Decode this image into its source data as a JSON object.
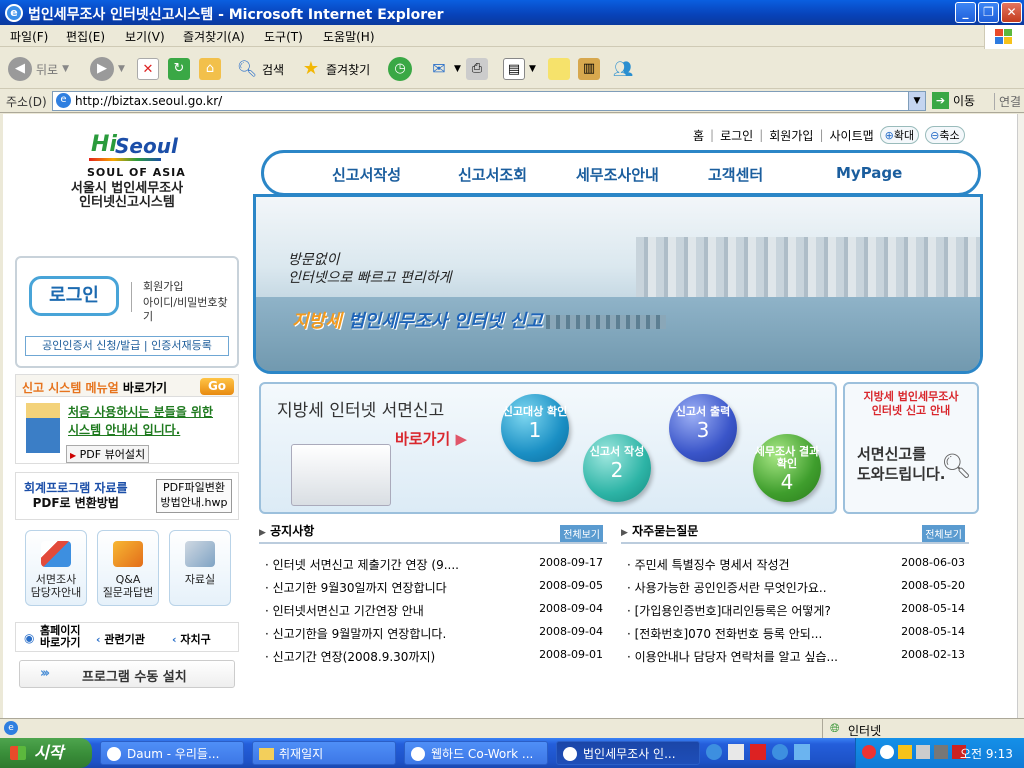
{
  "window": {
    "title": "법인세무조사 인터넷신고시스템 - Microsoft Internet Explorer"
  },
  "menu": [
    "파일(F)",
    "편집(E)",
    "보기(V)",
    "즐겨찾기(A)",
    "도구(T)",
    "도움말(H)"
  ],
  "toolbar": {
    "back": "뒤로",
    "search": "검색",
    "favorites": "즐겨찾기"
  },
  "address": {
    "label": "주소(D)",
    "url": "http://biztax.seoul.go.kr/",
    "go": "이동",
    "links": "연결"
  },
  "site": {
    "logo_hi": "Hi",
    "logo_seoul": "Seoul",
    "logo_sub": "SOUL OF ASIA",
    "title1": "서울시 법인세무조사",
    "title2": "인터넷신고시스템",
    "toplinks": [
      "홈",
      "로그인",
      "회원가입",
      "사이트맵"
    ],
    "zoom_in": "확대",
    "zoom_out": "축소",
    "nav": [
      "신고서작성",
      "신고서조회",
      "세무조사안내",
      "고객센터",
      "MyPage"
    ],
    "banner": {
      "line1": "방문없이",
      "line2": "인터넷으로 빠르고 편리하게",
      "headline_a": "지방세",
      "headline_b": "법인세무조사 인터넷 신고"
    },
    "login": {
      "button": "로그인",
      "join": "회원가입",
      "find": "아이디/비밀번호찾기",
      "cert": "공인인증서 신청/발급",
      "cert_reg": "인증서재등록"
    },
    "manual": {
      "title_a": "신고 시스템 메뉴얼",
      "title_b": "바로가기",
      "go": "Go",
      "line1": "처음 사용하시는 분들을 위한",
      "line2": "시스템 안내서 입니다.",
      "pdf": "PDF 뷰어설치"
    },
    "account": {
      "line1": "회계프로그램 자료를",
      "line2": "PDF로 변환방법",
      "btn1": "PDF파일변환",
      "btn2": "방법안내.hwp"
    },
    "quick": [
      {
        "l1": "서면조사",
        "l2": "담당자안내"
      },
      {
        "l1": "Q&A",
        "l2": "질문과답변"
      },
      {
        "l1": "자료실",
        "l2": ""
      }
    ],
    "homelinks": {
      "home1": "홈페이지",
      "home2": "바로가기",
      "org": "관련기관",
      "gu": "자치구"
    },
    "install": "프로그램 수동 설치",
    "seomyeon": {
      "title": "지방세 인터넷 서면신고",
      "shortcut": "바로가기",
      "steps": [
        {
          "label": "신고대상 확인",
          "n": "1"
        },
        {
          "label": "신고서 작성",
          "n": "2"
        },
        {
          "label": "신고서 출력",
          "n": "3"
        },
        {
          "label": "세무조사 결과확인",
          "n": "4"
        }
      ]
    },
    "guide": {
      "title1": "지방세 법인세무조사",
      "title2": "인터넷 신고 안내",
      "body1": "서면신고를",
      "body2": "도와드립니다."
    },
    "notice": {
      "title": "공지사항",
      "more": "전체보기",
      "items": [
        {
          "t": "· 인터넷 서면신고 제출기간 연장 (9....",
          "d": "2008-09-17"
        },
        {
          "t": "· 신고기한 9월30일까지 연장합니다",
          "d": "2008-09-05"
        },
        {
          "t": "· 인터넷서면신고 기간연장 안내",
          "d": "2008-09-04"
        },
        {
          "t": "· 신고기한을 9월말까지 연장합니다.",
          "d": "2008-09-04"
        },
        {
          "t": "· 신고기간 연장(2008.9.30까지)",
          "d": "2008-09-01"
        }
      ]
    },
    "faq": {
      "title": "자주묻는질문",
      "more": "전체보기",
      "items": [
        {
          "t": "· 주민세 특별징수 명세서 작성건",
          "d": "2008-06-03"
        },
        {
          "t": "· 사용가능한 공인인증서란 무엇인가요..",
          "d": "2008-05-20"
        },
        {
          "t": "· [가입용인증번호]대리인등록은 어떻게?",
          "d": "2008-05-14"
        },
        {
          "t": "· [전화번호]070 전화번호 등록 안되...",
          "d": "2008-05-14"
        },
        {
          "t": "· 이용안내나 담당자 연락처를 알고 싶습...",
          "d": "2008-02-13"
        }
      ]
    }
  },
  "status": {
    "zone": "인터넷"
  },
  "taskbar": {
    "start": "시작",
    "tasks": [
      "Daum - 우리들...",
      "취재일지",
      "웹하드 Co-Work ...",
      "법인세무조사 인..."
    ],
    "clock": "오전 9:13"
  }
}
